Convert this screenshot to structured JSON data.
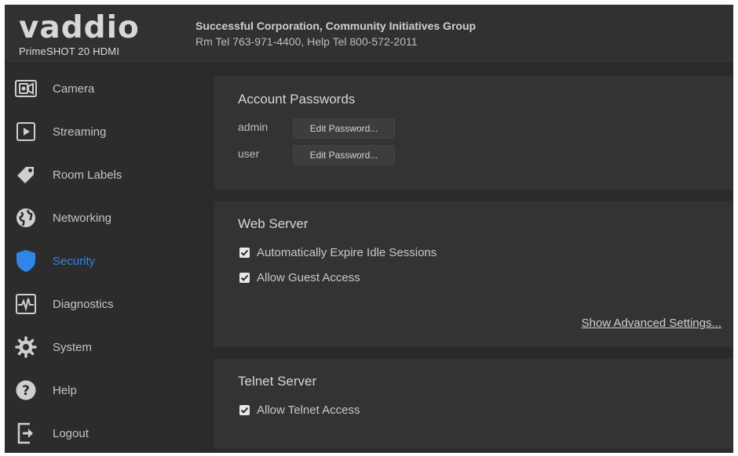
{
  "header": {
    "logo_text": "vaddio",
    "model": "PrimeSHOT 20 HDMI",
    "organization": "Successful Corporation, Community Initiatives Group",
    "contact": "Rm Tel 763-971-4400, Help Tel 800-572-2011"
  },
  "sidebar": {
    "items": [
      {
        "label": "Camera",
        "icon": "camera-icon"
      },
      {
        "label": "Streaming",
        "icon": "play-icon"
      },
      {
        "label": "Room Labels",
        "icon": "tag-icon"
      },
      {
        "label": "Networking",
        "icon": "globe-icon"
      },
      {
        "label": "Security",
        "icon": "shield-icon",
        "active": true
      },
      {
        "label": "Diagnostics",
        "icon": "pulse-icon"
      },
      {
        "label": "System",
        "icon": "gear-icon"
      },
      {
        "label": "Help",
        "icon": "help-icon"
      },
      {
        "label": "Logout",
        "icon": "logout-icon"
      }
    ],
    "active_color": "#2f86e6"
  },
  "account_passwords": {
    "title": "Account Passwords",
    "rows": [
      {
        "user": "admin",
        "button": "Edit Password..."
      },
      {
        "user": "user",
        "button": "Edit Password..."
      }
    ]
  },
  "web_server": {
    "title": "Web Server",
    "options": [
      {
        "label": "Automatically Expire Idle Sessions",
        "checked": true
      },
      {
        "label": "Allow Guest Access",
        "checked": true
      }
    ],
    "advanced_link": "Show Advanced Settings..."
  },
  "telnet_server": {
    "title": "Telnet Server",
    "options": [
      {
        "label": "Allow Telnet Access",
        "checked": true
      }
    ]
  }
}
